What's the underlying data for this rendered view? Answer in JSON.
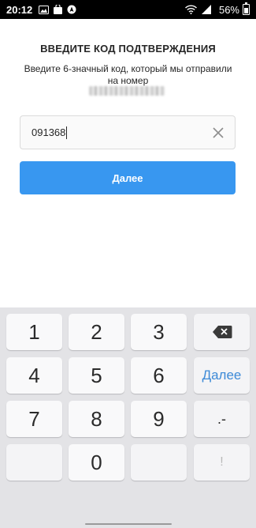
{
  "status_bar": {
    "time": "20:12",
    "battery": "56%",
    "left_icons": [
      "image-icon",
      "bag-icon",
      "navigation-icon"
    ],
    "right_icons": [
      "wifi-icon",
      "signal-icon",
      "battery-icon"
    ]
  },
  "screen": {
    "title": "ВВЕДИТЕ КОД ПОДТВЕРЖДЕНИЯ",
    "subtitle": "Введите 6-значный код, который мы отправили на номер",
    "code_value": "091368",
    "next_button": "Далее"
  },
  "keyboard": {
    "keys": [
      "1",
      "2",
      "3",
      "4",
      "5",
      "6",
      "7",
      "8",
      "9",
      "0"
    ],
    "action_label": "Далее",
    "punct_label": ".-",
    "excl_label": "!"
  },
  "colors": {
    "accent": "#3897f0",
    "keyboard_bg": "#e3e3e6",
    "action_text": "#3d8ad7"
  }
}
